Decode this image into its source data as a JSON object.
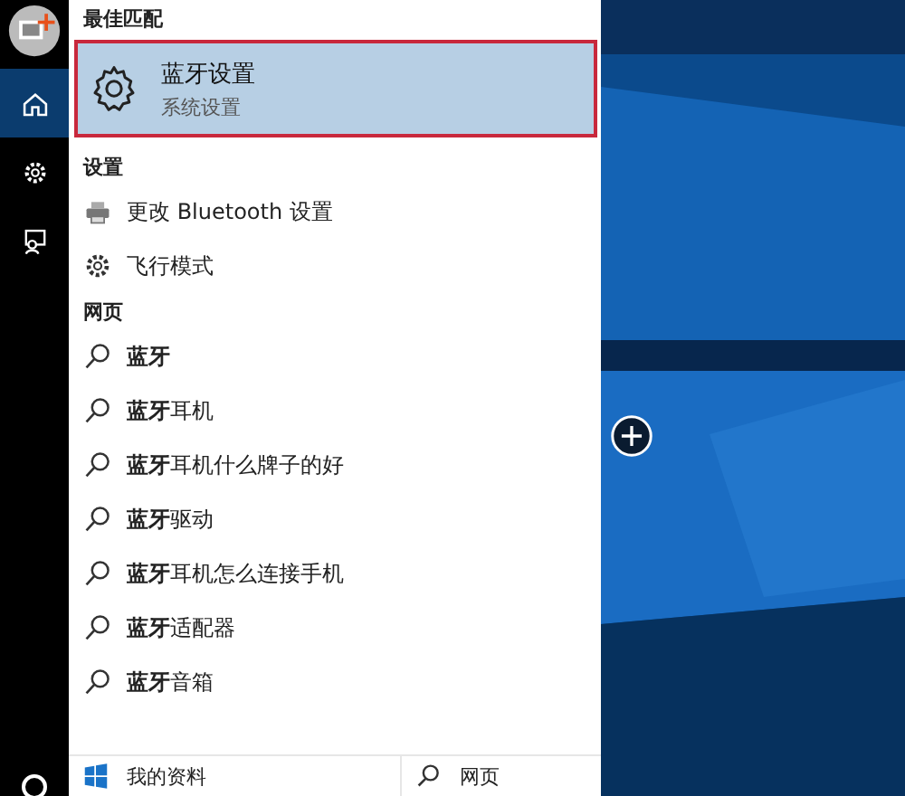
{
  "rail": {
    "items": [
      {
        "kind": "home",
        "selected": true
      },
      {
        "kind": "settings",
        "selected": false
      },
      {
        "kind": "feedback",
        "selected": false
      }
    ]
  },
  "best_match": {
    "heading": "最佳匹配",
    "title": "蓝牙设置",
    "subtitle": "系统设置",
    "selected": true
  },
  "settings": {
    "heading": "设置",
    "items": [
      {
        "kind": "device",
        "label": "更改 Bluetooth 设置"
      },
      {
        "kind": "gear",
        "label": "飞行模式"
      }
    ]
  },
  "web": {
    "heading": "网页",
    "items": [
      "**蓝牙**",
      "**蓝牙**耳机",
      "**蓝牙**耳机什么牌子的好",
      "**蓝牙**驱动",
      "**蓝牙**耳机怎么连接手机",
      "**蓝牙**适配器",
      "**蓝牙**音箱"
    ]
  },
  "bottom_tabs": [
    {
      "kind": "windows",
      "label": "我的资料"
    },
    {
      "kind": "search",
      "label": "网页"
    }
  ]
}
